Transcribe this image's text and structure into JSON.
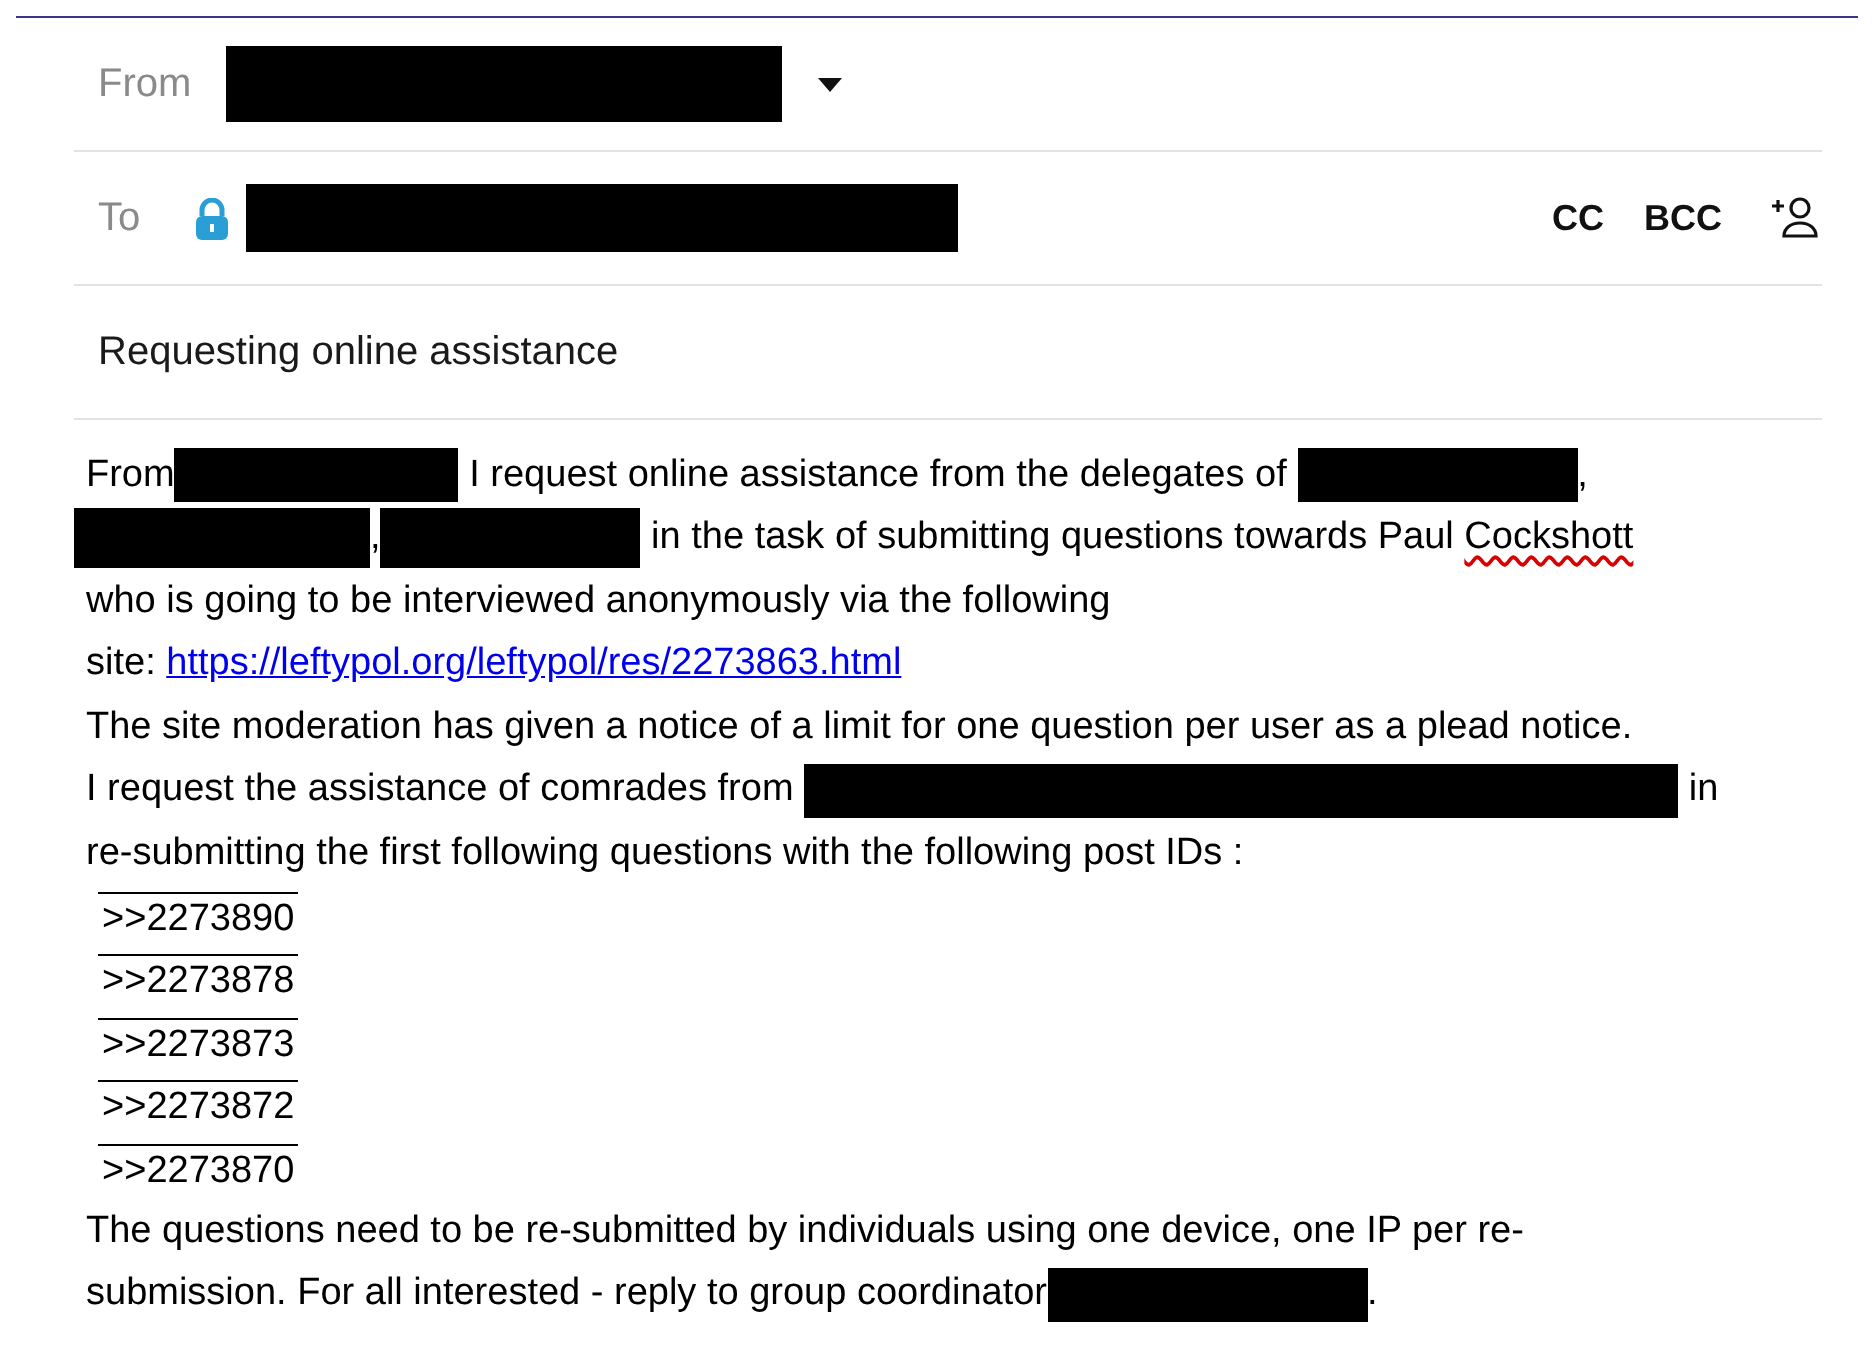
{
  "from": {
    "label": "From"
  },
  "to": {
    "label": "To",
    "actions": [
      "CC",
      "BCC"
    ]
  },
  "subject": {
    "value": "Requesting online assistance"
  },
  "body": {
    "lines": [
      [
        {
          "kind": "text",
          "text": "From"
        },
        {
          "kind": "redaction"
        },
        {
          "kind": "text",
          "text": " I request online assistance from the delegates of "
        },
        {
          "kind": "redaction"
        },
        {
          "kind": "text",
          "text": ","
        }
      ],
      [
        {
          "kind": "redaction"
        },
        {
          "kind": "text",
          "text": ","
        },
        {
          "kind": "redaction"
        },
        {
          "kind": "text",
          "text": " in the task of submitting questions towards Paul "
        },
        {
          "kind": "misspelled",
          "text": "Cockshott"
        }
      ],
      [
        {
          "kind": "text",
          "text": "who is going to be interviewed anonymously via the following"
        }
      ],
      [
        {
          "kind": "text",
          "text": "site: "
        },
        {
          "kind": "link",
          "text": "https://leftypol.org/leftypol/res/2273863.html"
        }
      ],
      [
        {
          "kind": "text",
          "text": "The site moderation has given a notice of a limit for one question per user as a plead notice."
        }
      ],
      [
        {
          "kind": "text",
          "text": "I request the assistance of comrades from "
        },
        {
          "kind": "redaction"
        },
        {
          "kind": "text",
          "text": " in"
        }
      ],
      [
        {
          "kind": "text",
          "text": "re-submitting the first following questions with the following post IDs :"
        }
      ],
      [
        {
          "kind": "post-id",
          "text": ">>2273890"
        }
      ],
      [
        {
          "kind": "post-id",
          "text": ">>2273878"
        }
      ],
      [
        {
          "kind": "post-id",
          "text": ">>2273873"
        }
      ],
      [
        {
          "kind": "post-id",
          "text": ">>2273872"
        }
      ],
      [
        {
          "kind": "post-id",
          "text": ">>2273870"
        }
      ],
      [
        {
          "kind": "text",
          "text": "The questions need to be re-submitted by individuals using one device, one IP per re-"
        }
      ],
      [
        {
          "kind": "text",
          "text": "submission. For all interested - reply to group coordinator"
        },
        {
          "kind": "redaction"
        },
        {
          "kind": "text",
          "text": "."
        }
      ]
    ]
  }
}
